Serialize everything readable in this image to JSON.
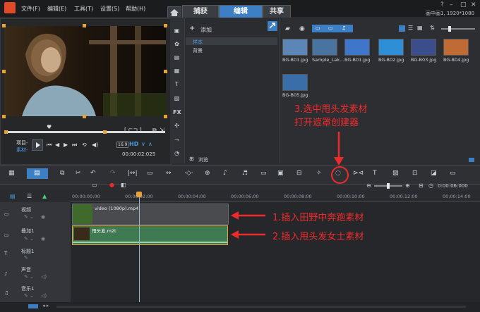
{
  "menu": {
    "file": "文件(F)",
    "edit": "编辑(E)",
    "tools": "工具(T)",
    "settings": "设置(S)",
    "help": "帮助(H)"
  },
  "tabs": {
    "capture": "捕获",
    "edit": "编辑",
    "share": "共享"
  },
  "project_info": "画中画1, 1920*1080",
  "preview": {
    "mode_project": "项目-",
    "mode_clip": "素材-",
    "hd": "HD",
    "timecode": "00:00:02:025"
  },
  "library": {
    "add_label": "添加",
    "folders": [
      "样本",
      "背景"
    ],
    "browse_label": "浏览"
  },
  "media": {
    "items": [
      {
        "name": "BG-B01.jpg",
        "color": "#5b86b5"
      },
      {
        "name": "Sample_Lak...",
        "color": "#4a74a0"
      },
      {
        "name": "BG-B01.jpg",
        "color": "#3e77c9"
      },
      {
        "name": "BG-B02.jpg",
        "color": "#2f8fd6"
      },
      {
        "name": "BG-B03.jpg",
        "color": "#3b4d8c"
      },
      {
        "name": "BG-B04.jpg",
        "color": "#c06b35"
      },
      {
        "name": "BG-B05.jpg",
        "color": "#3a6ea8"
      }
    ]
  },
  "annotations": {
    "step3_line1": "3.选中甩头发素材",
    "step3_line2": "打开遮罩创建器",
    "step1": "1.插入田野中奔跑素材",
    "step2": "2.插入甩头发女士素材"
  },
  "timeline": {
    "ruler": [
      "00:00:00:00",
      "00:00:02:00",
      "00:00:04:00",
      "00:00:06:00",
      "00:00:08:00",
      "00:00:10:00",
      "00:00:12:00",
      "00:00:14:00"
    ],
    "zoom_time": "0:00:06:000",
    "tracks": [
      "视频",
      "叠加1",
      "标题1",
      "声音",
      "音乐1"
    ],
    "clip_video": "video (1080p).mp4",
    "clip_overlay": "甩头发.m2t"
  },
  "colors": {
    "accent": "#3d7fc4",
    "overlay_clip": "#3f7a52",
    "annotation": "#ee2b2b",
    "mark": "#e8a23a"
  }
}
